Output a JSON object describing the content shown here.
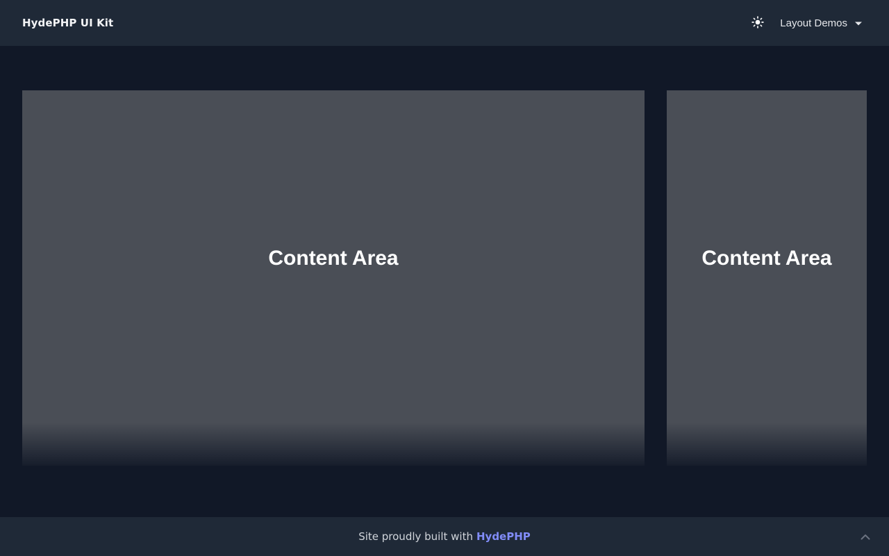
{
  "navbar": {
    "brand": "HydePHP UI Kit",
    "theme_toggle_icon": "sun-icon",
    "dropdown_label": "Layout Demos",
    "dropdown_icon": "caret-down-icon"
  },
  "content": {
    "main_panel_label": "Content Area",
    "side_panel_label": "Content Area"
  },
  "footer": {
    "text": "Site proudly built with",
    "link_text": "HydePHP",
    "back_to_top_icon": "chevron-up-icon"
  },
  "colors": {
    "page_background": "#111827",
    "navbar_background": "#1f2937",
    "panel_background": "#4a4e56",
    "link_accent": "#818cf8"
  }
}
